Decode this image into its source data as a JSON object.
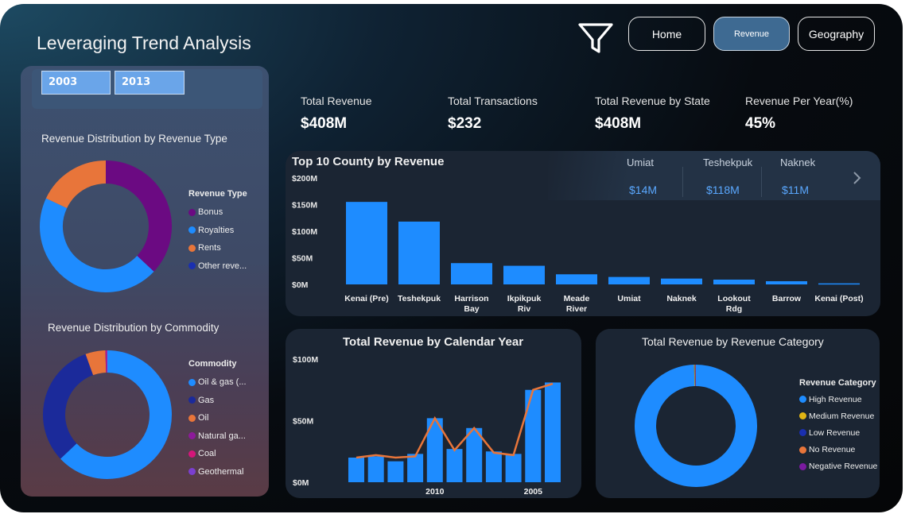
{
  "header": {
    "title": "Leveraging Trend Analysis",
    "nav": [
      "Home",
      "Revenue",
      "Geography"
    ],
    "active_nav": "Revenue"
  },
  "slicer": {
    "years": [
      "2003",
      "2013"
    ]
  },
  "kpis": [
    {
      "label": "Total Revenue",
      "value": "$408M"
    },
    {
      "label": "Total Transactions",
      "value": "$232"
    },
    {
      "label": "Total Revenue by State",
      "value": "$408M"
    },
    {
      "label": "Revenue Per Year(%)",
      "value": "45%"
    }
  ],
  "revenue_type": {
    "title": "Revenue Distribution by Revenue Type",
    "legend_title": "Revenue Type",
    "legend": [
      "Bonus",
      "Royalties",
      "Rents",
      "Other reve..."
    ],
    "colors": {
      "Bonus": "#6b0a82",
      "Royalties": "#1e8cff",
      "Rents": "#e8753a",
      "Other": "#1a2fb0"
    }
  },
  "commodity": {
    "title": "Revenue Distribution by Commodity",
    "legend_title": "Commodity",
    "legend": [
      "Oil & gas (...",
      "Gas",
      "Oil",
      "Natural ga...",
      "Coal",
      "Geothermal"
    ],
    "colors": [
      "#1e8cff",
      "#1b2a9a",
      "#e8753a",
      "#8d1a9a",
      "#d4167a",
      "#7b3fd0"
    ]
  },
  "top_county": {
    "title": "Top 10 County by Revenue",
    "highlights": [
      {
        "name": "Umiat",
        "value": "$14M"
      },
      {
        "name": "Teshekpuk",
        "value": "$118M"
      },
      {
        "name": "Naknek",
        "value": "$11M"
      }
    ]
  },
  "calendar": {
    "title": "Total Revenue by Calendar Year"
  },
  "category": {
    "title": "Total Revenue by Revenue Category",
    "legend_title": "Revenue Category",
    "legend": [
      "High Revenue",
      "Medium Revenue",
      "Low Revenue",
      "No Revenue",
      "Negative Revenue"
    ],
    "colors": [
      "#1e8cff",
      "#e0b414",
      "#1a2fb0",
      "#e8753a",
      "#7a1aa0"
    ]
  },
  "chart_data": [
    {
      "type": "pie",
      "title": "Revenue Distribution by Revenue Type",
      "labels": [
        "Bonus",
        "Royalties",
        "Rents",
        "Other reve..."
      ],
      "values": [
        37,
        45,
        18,
        0
      ]
    },
    {
      "type": "pie",
      "title": "Revenue Distribution by Commodity",
      "labels": [
        "Oil & gas (...",
        "Gas",
        "Oil",
        "Natural ga...",
        "Coal",
        "Geothermal"
      ],
      "values": [
        63,
        31.5,
        5,
        0.2,
        0.2,
        0.1
      ]
    },
    {
      "type": "bar",
      "title": "Top 10 County by Revenue",
      "categories": [
        "Kenai (Pre)",
        "Teshekpuk",
        "Harrison Bay",
        "Ikpikpuk Riv",
        "Meade River",
        "Umiat",
        "Naknek",
        "Lookout Rdg",
        "Barrow",
        "Kenai (Post)"
      ],
      "values": [
        155,
        118,
        40,
        35,
        19,
        14,
        11,
        9,
        6,
        2
      ],
      "yticks": [
        "$0M",
        "$50M",
        "$100M",
        "$150M",
        "$200M"
      ],
      "ylim": [
        0,
        200
      ]
    },
    {
      "type": "bar",
      "title": "Total Revenue by Calendar Year",
      "values": [
        20,
        21,
        17,
        23,
        52,
        27,
        44,
        25,
        23,
        75,
        81
      ],
      "line": [
        20,
        22,
        20,
        21,
        52,
        26,
        44,
        24,
        22,
        75,
        80
      ],
      "xticks": [
        "2010",
        "2005"
      ],
      "yticks": [
        "$0M",
        "$50M",
        "$100M"
      ],
      "ylim": [
        0,
        100
      ]
    },
    {
      "type": "pie",
      "title": "Total Revenue by Revenue Category",
      "labels": [
        "High Revenue",
        "Medium Revenue",
        "Low Revenue",
        "No Revenue",
        "Negative Revenue"
      ],
      "values": [
        99.5,
        0.2,
        0.1,
        0.1,
        0.1
      ]
    }
  ]
}
